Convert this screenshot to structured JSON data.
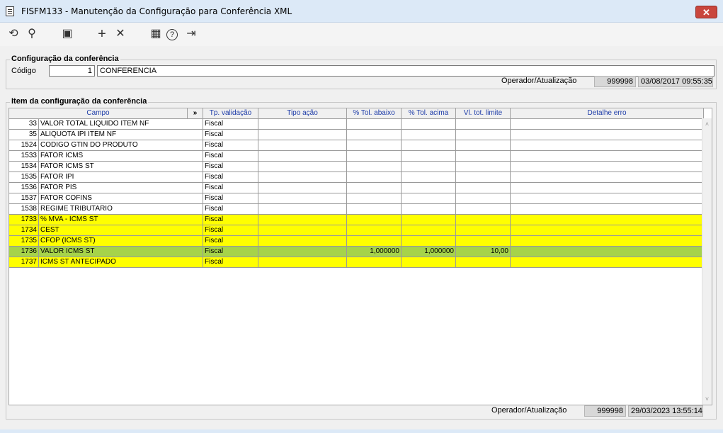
{
  "window": {
    "title": "FISFM133 - Manutenção da Configuração para Conferência XML",
    "close_label": "✕"
  },
  "toolbar": [
    {
      "name": "refresh-icon",
      "glyph": "⟲"
    },
    {
      "name": "search-icon",
      "glyph": "⚲"
    },
    {
      "name": "save-icon",
      "glyph": "▣"
    },
    {
      "name": "add-icon",
      "glyph": "+"
    },
    {
      "name": "delete-icon",
      "glyph": "✕"
    },
    {
      "name": "calendar-icon",
      "glyph": "▦"
    },
    {
      "name": "help-icon",
      "glyph": "?"
    },
    {
      "name": "exit-icon",
      "glyph": "⇥"
    }
  ],
  "config": {
    "group_label": "Configuração da conferência",
    "codigo_label": "Código",
    "codigo_value": "1",
    "descricao_value": "CONFERENCIA",
    "operador_label": "Operador/Atualização",
    "operador_value": "999998",
    "data_value": "03/08/2017 09:55:35"
  },
  "items": {
    "group_label": "Item da configuração da conferência",
    "headers": {
      "campo": "Campo",
      "expand": "»",
      "tp_validacao": "Tp. validação",
      "tipo_acao": "Tipo ação",
      "tol_abaixo": "% Tol. abaixo",
      "tol_acima": "% Tol. acima",
      "vl_tot_limite": "Vl. tot. limite",
      "detalhe_erro": "Detalhe erro"
    },
    "rows": [
      {
        "code": "33",
        "name": "VALOR TOTAL LIQUIDO ITEM NF",
        "tp": "Fiscal",
        "acao": "",
        "abaixo": "",
        "acima": "",
        "limite": "",
        "detalhe": "",
        "style": "white"
      },
      {
        "code": "35",
        "name": "ALIQUOTA IPI ITEM NF",
        "tp": "Fiscal",
        "acao": "",
        "abaixo": "",
        "acima": "",
        "limite": "",
        "detalhe": "",
        "style": "white"
      },
      {
        "code": "1524",
        "name": "CODIGO GTIN DO PRODUTO",
        "tp": "Fiscal",
        "acao": "",
        "abaixo": "",
        "acima": "",
        "limite": "",
        "detalhe": "",
        "style": "white"
      },
      {
        "code": "1533",
        "name": "FATOR ICMS",
        "tp": "Fiscal",
        "acao": "",
        "abaixo": "",
        "acima": "",
        "limite": "",
        "detalhe": "",
        "style": "white"
      },
      {
        "code": "1534",
        "name": "FATOR ICMS ST",
        "tp": "Fiscal",
        "acao": "",
        "abaixo": "",
        "acima": "",
        "limite": "",
        "detalhe": "",
        "style": "white"
      },
      {
        "code": "1535",
        "name": "FATOR IPI",
        "tp": "Fiscal",
        "acao": "",
        "abaixo": "",
        "acima": "",
        "limite": "",
        "detalhe": "",
        "style": "white"
      },
      {
        "code": "1536",
        "name": "FATOR PIS",
        "tp": "Fiscal",
        "acao": "",
        "abaixo": "",
        "acima": "",
        "limite": "",
        "detalhe": "",
        "style": "white"
      },
      {
        "code": "1537",
        "name": "FATOR COFINS",
        "tp": "Fiscal",
        "acao": "",
        "abaixo": "",
        "acima": "",
        "limite": "",
        "detalhe": "",
        "style": "white"
      },
      {
        "code": "1538",
        "name": "REGIME TRIBUTARIO",
        "tp": "Fiscal",
        "acao": "",
        "abaixo": "",
        "acima": "",
        "limite": "",
        "detalhe": "",
        "style": "white"
      },
      {
        "code": "1733",
        "name": "% MVA - ICMS ST",
        "tp": "Fiscal",
        "acao": "",
        "abaixo": "",
        "acima": "",
        "limite": "",
        "detalhe": "",
        "style": "yellow"
      },
      {
        "code": "1734",
        "name": "CEST",
        "tp": "Fiscal",
        "acao": "",
        "abaixo": "",
        "acima": "",
        "limite": "",
        "detalhe": "",
        "style": "yellow"
      },
      {
        "code": "1735",
        "name": "CFOP (ICMS ST)",
        "tp": "Fiscal",
        "acao": "",
        "abaixo": "",
        "acima": "",
        "limite": "",
        "detalhe": "",
        "style": "yellow"
      },
      {
        "code": "1736",
        "name": "VALOR ICMS ST",
        "tp": "Fiscal",
        "acao": "",
        "abaixo": "1,000000",
        "acima": "1,000000",
        "limite": "10,00",
        "detalhe": "",
        "style": "green"
      },
      {
        "code": "1737",
        "name": "ICMS ST ANTECIPADO",
        "tp": "Fiscal",
        "acao": "",
        "abaixo": "",
        "acima": "",
        "limite": "",
        "detalhe": "",
        "style": "yellow"
      }
    ],
    "operador_label": "Operador/Atualização",
    "operador_value": "999998",
    "data_value": "29/03/2023 13:55:14"
  },
  "colors": {
    "highlight_yellow": "#ffff00",
    "selected_green": "#a6d34a",
    "header_text": "#1c3ba8"
  }
}
